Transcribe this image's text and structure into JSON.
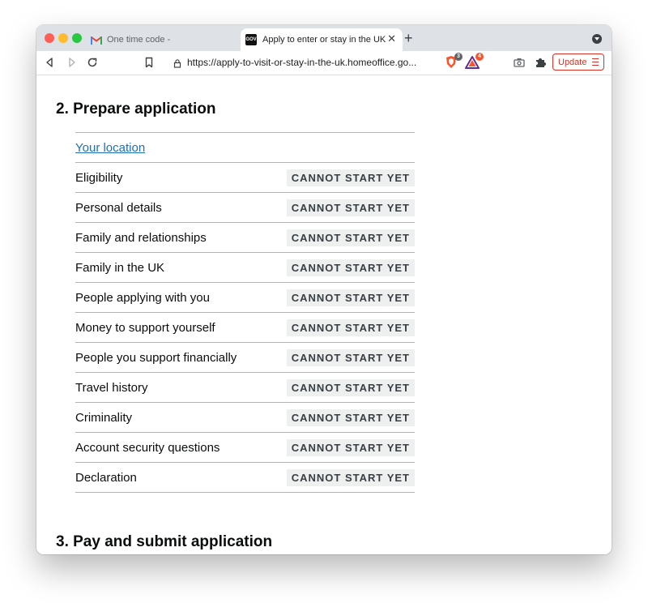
{
  "browser": {
    "tabs": [
      {
        "title": "One time code -",
        "active": false
      },
      {
        "title": "Apply to enter or stay in the UK",
        "active": true
      }
    ],
    "favicon_text": "GOV UK",
    "url": "https://apply-to-visit-or-stay-in-the-uk.homeoffice.go...",
    "brave_shield_count": "3",
    "rewards_count": "4",
    "update_label": "Update"
  },
  "colors": {
    "link": "#1d70b8",
    "status_bg": "#eeefef",
    "update_red": "#d93025"
  },
  "page": {
    "section2_heading": "2. Prepare application",
    "section3_heading": "3. Pay and submit application",
    "location_link": "Your location",
    "tasks": [
      {
        "name": "Eligibility",
        "status": "CANNOT START YET"
      },
      {
        "name": "Personal details",
        "status": "CANNOT START YET"
      },
      {
        "name": "Family and relationships",
        "status": "CANNOT START YET"
      },
      {
        "name": "Family in the UK",
        "status": "CANNOT START YET"
      },
      {
        "name": "People applying with you",
        "status": "CANNOT START YET"
      },
      {
        "name": "Money to support yourself",
        "status": "CANNOT START YET"
      },
      {
        "name": "People you support financially",
        "status": "CANNOT START YET"
      },
      {
        "name": "Travel history",
        "status": "CANNOT START YET"
      },
      {
        "name": "Criminality",
        "status": "CANNOT START YET"
      },
      {
        "name": "Account security questions",
        "status": "CANNOT START YET"
      },
      {
        "name": "Declaration",
        "status": "CANNOT START YET"
      }
    ]
  }
}
